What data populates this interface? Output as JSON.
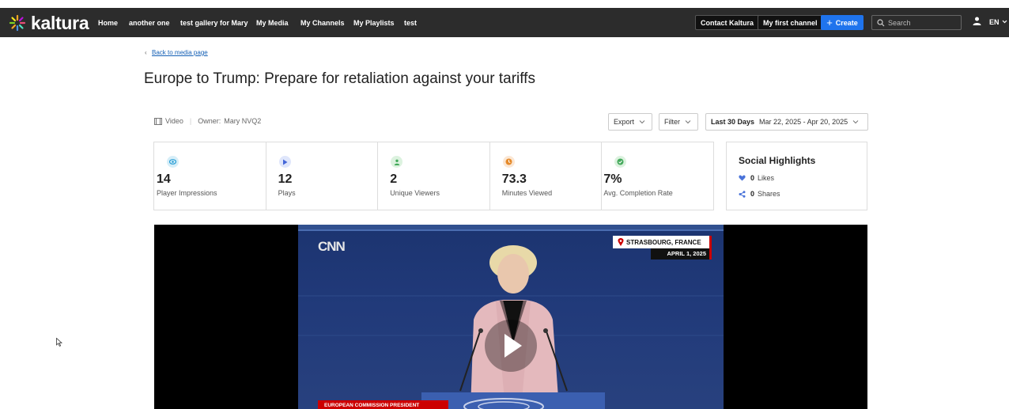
{
  "brand": {
    "name": "kaltura"
  },
  "nav": {
    "items": [
      "Home",
      "another one",
      "test gallery for Mary",
      "My Media",
      "My Channels",
      "My Playlists",
      "test"
    ],
    "contact": "Contact Kaltura",
    "channel": "My first channel",
    "create": "Create",
    "search_placeholder": "Search",
    "language": "EN"
  },
  "page": {
    "back_chevron": "‹",
    "back_label": "Back to media page",
    "title": "Europe to Trump: Prepare for retaliation against your tariffs"
  },
  "meta": {
    "type": "Video",
    "owner_label": "Owner:",
    "owner": "Mary NVQ2"
  },
  "controls": {
    "export": "Export",
    "filter": "Filter",
    "range_label": "Last 30 Days",
    "range_value": "Mar 22, 2025 - Apr 20, 2025"
  },
  "stats": [
    {
      "value": "14",
      "label": "Player Impressions",
      "icon": "eye-icon",
      "bg": "#d6eef8",
      "fg": "#2b9fd6"
    },
    {
      "value": "12",
      "label": "Plays",
      "icon": "play-icon",
      "bg": "#dfe6fb",
      "fg": "#4466d8"
    },
    {
      "value": "2",
      "label": "Unique Viewers",
      "icon": "user-icon",
      "bg": "#dcf2df",
      "fg": "#43a95a"
    },
    {
      "value": "73.3",
      "label": "Minutes Viewed",
      "icon": "clock-icon",
      "bg": "#fbe7d4",
      "fg": "#e58a2b"
    },
    {
      "value": "7%",
      "label": "Avg. Completion Rate",
      "icon": "check-icon",
      "bg": "#dcf2df",
      "fg": "#43a95a"
    }
  ],
  "social": {
    "title": "Social Highlights",
    "likes_value": "0",
    "likes_label": "Likes",
    "shares_value": "0",
    "shares_label": "Shares"
  },
  "video": {
    "network": "CNN",
    "location": "STRASBOURG, FRANCE",
    "date": "APRIL 1, 2025",
    "lower_third": "EUROPEAN COMMISSION PRESIDENT"
  },
  "colors": {
    "topbar": "#2c2c2c",
    "accent": "#1f74ed",
    "link": "#1560b5"
  }
}
